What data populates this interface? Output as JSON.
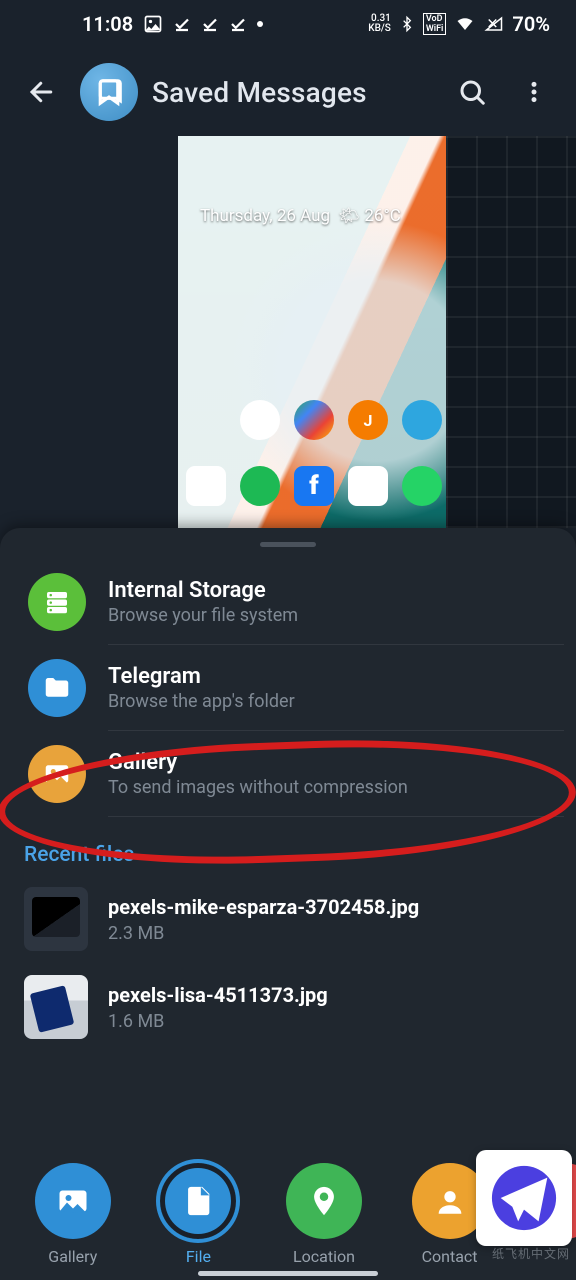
{
  "statusbar": {
    "time": "11:08",
    "net_rate": "0.31",
    "net_unit": "KB/S",
    "wifi_badge": "VoD WiFi",
    "battery_pct": "70%"
  },
  "appbar": {
    "title": "Saved Messages"
  },
  "preview": {
    "date_overlay": "Thursday, 26 Aug",
    "temp_overlay": "26°C"
  },
  "sources": [
    {
      "title": "Internal Storage",
      "sub": "Browse your file system"
    },
    {
      "title": "Telegram",
      "sub": "Browse the app's folder"
    },
    {
      "title": "Gallery",
      "sub": "To send images without compression"
    }
  ],
  "recent": {
    "header": "Recent files",
    "files": [
      {
        "name": "pexels-mike-esparza-3702458.jpg",
        "size": "2.3 MB"
      },
      {
        "name": "pexels-lisa-4511373.jpg",
        "size": "1.6 MB"
      }
    ]
  },
  "actions": {
    "gallery": "Gallery",
    "file": "File",
    "location": "Location",
    "contact": "Contact"
  },
  "promo_caption": "纸飞机中文网"
}
